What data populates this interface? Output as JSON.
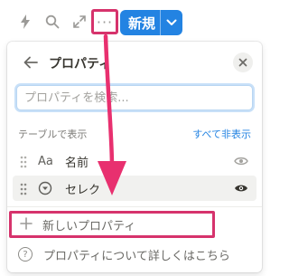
{
  "toolbar": {
    "icons": [
      "bolt-icon",
      "search-icon",
      "expand-icon",
      "more-icon"
    ],
    "more_label": "···",
    "new_button": {
      "label": "新規",
      "color": "#2383e2"
    }
  },
  "panel": {
    "title": "プロパティ",
    "search": {
      "placeholder": "プロパティを検索...",
      "value": ""
    },
    "section_label": "テーブルで表示",
    "hide_all_label": "すべて非表示",
    "properties": [
      {
        "type_icon": "Aa",
        "type_icon_name": "text-type-icon",
        "name": "名前",
        "visible": true
      },
      {
        "type_icon": "▿",
        "type_icon_name": "select-type-icon",
        "name": "セレク",
        "visible": true
      }
    ],
    "new_property_label": "新しいプロパティ",
    "help_label": "プロパティについて詳しくはこちら",
    "help_icon": "?"
  },
  "colors": {
    "accent": "#2383e2",
    "highlight": "#d6336c"
  }
}
